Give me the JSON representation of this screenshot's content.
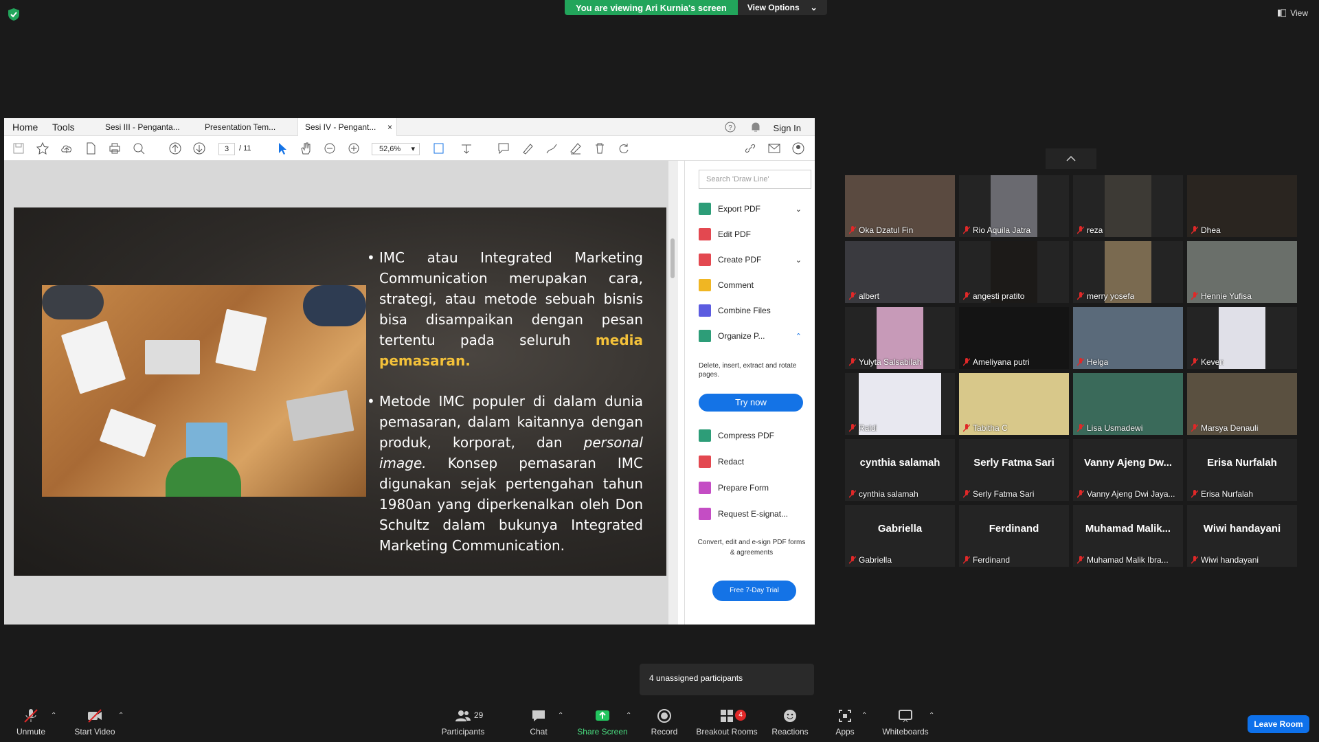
{
  "zoom_top": {
    "viewing_banner": "You are viewing Ari Kurnia's screen",
    "view_options": "View Options",
    "view_label": "View"
  },
  "acrobat": {
    "nav_home": "Home",
    "nav_tools": "Tools",
    "tabs": [
      {
        "label": "Sesi III - Penganta..."
      },
      {
        "label": "Presentation Tem..."
      },
      {
        "label": "Sesi IV - Pengant..."
      }
    ],
    "tab_close": "×",
    "sign_in": "Sign In",
    "page_current": "3",
    "page_total": "/ 11",
    "zoom": "52,6%",
    "search_placeholder": "Search 'Draw Line'",
    "tools": [
      {
        "label": "Export PDF",
        "color": "#2d9d78"
      },
      {
        "label": "Edit PDF",
        "color": "#e34850"
      },
      {
        "label": "Create PDF",
        "color": "#e34850"
      },
      {
        "label": "Comment",
        "color": "#f0b623"
      },
      {
        "label": "Combine Files",
        "color": "#5c5ce0"
      },
      {
        "label": "Organize P...",
        "color": "#2d9d78"
      },
      {
        "label": "Compress PDF",
        "color": "#2d9d78"
      },
      {
        "label": "Redact",
        "color": "#e34850"
      },
      {
        "label": "Prepare Form",
        "color": "#c44dc4"
      },
      {
        "label": "Request E-signat...",
        "color": "#c44dc4"
      }
    ],
    "organize_desc": "Delete, insert, extract and rotate pages.",
    "try_now": "Try now",
    "convert_desc": "Convert, edit and e-sign PDF forms & agreements",
    "free_trial": "Free 7-Day Trial"
  },
  "slide": {
    "bullet1_text": "IMC atau Integrated Marketing Communication merupakan cara, strategi, atau metode sebuah bisnis bisa disampaikan dengan pesan tertentu pada seluruh ",
    "bullet1_highlight": "media pemasaran.",
    "bullet2_part1": "Metode IMC populer di dalam dunia pemasaran, dalam kaitannya dengan produk, korporat, dan ",
    "bullet2_italic": "personal image.",
    "bullet2_part2": " Konsep pemasaran IMC digunakan sejak pertengahan tahun 1980an yang diperkenalkan oleh Don Schultz dalam bukunya Integrated Marketing Communication."
  },
  "participants": [
    {
      "name": "Oka Dzatul Fin",
      "big": ""
    },
    {
      "name": "Rio Aquila Jatra",
      "big": ""
    },
    {
      "name": "reza",
      "big": ""
    },
    {
      "name": "Dhea",
      "big": ""
    },
    {
      "name": "albert",
      "big": ""
    },
    {
      "name": "angesti pratito",
      "big": ""
    },
    {
      "name": "merry yosefa",
      "big": ""
    },
    {
      "name": "Hennie Yufisa",
      "big": ""
    },
    {
      "name": "Yulyta Salsabilah",
      "big": ""
    },
    {
      "name": "Ameliyana putri",
      "big": ""
    },
    {
      "name": "Helga",
      "big": ""
    },
    {
      "name": "Keven",
      "big": ""
    },
    {
      "name": "Raldi",
      "big": ""
    },
    {
      "name": "Tabitha C",
      "big": ""
    },
    {
      "name": "Lisa Usmadewi",
      "big": ""
    },
    {
      "name": "Marsya Denauli",
      "big": ""
    },
    {
      "name": "cynthia salamah",
      "big": "cynthia salamah"
    },
    {
      "name": "Serly Fatma Sari",
      "big": "Serly Fatma Sari"
    },
    {
      "name": "Vanny Ajeng Dwi Jaya...",
      "big": "Vanny Ajeng Dw..."
    },
    {
      "name": "Erisa Nurfalah",
      "big": "Erisa Nurfalah"
    },
    {
      "name": "Gabriella",
      "big": "Gabriella"
    },
    {
      "name": "Ferdinand",
      "big": "Ferdinand"
    },
    {
      "name": "Muhamad Malik Ibra...",
      "big": "Muhamad  Malik..."
    },
    {
      "name": "Wiwi handayani",
      "big": "Wiwi handayani"
    }
  ],
  "unassigned": "4 unassigned participants",
  "controls": {
    "unmute": "Unmute",
    "start_video": "Start Video",
    "participants": "Participants",
    "participants_count": "29",
    "chat": "Chat",
    "share_screen": "Share Screen",
    "record": "Record",
    "breakout_rooms": "Breakout Rooms",
    "breakout_badge": "4",
    "reactions": "Reactions",
    "apps": "Apps",
    "whiteboards": "Whiteboards",
    "leave_room": "Leave Room"
  },
  "colors": {
    "zoom_green": "#22a55b",
    "acrobat_blue": "#1473e6",
    "zoom_blue": "#0e71eb",
    "highlight_yellow": "#f3c13a"
  }
}
